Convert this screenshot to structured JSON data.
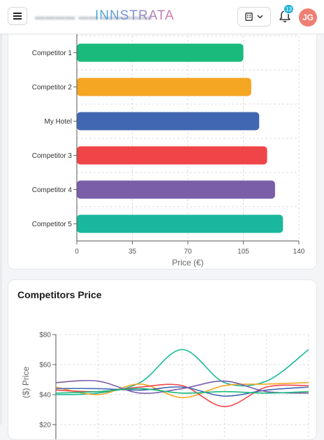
{
  "header": {
    "menu_icon": "hamburger-icon",
    "logo_text": "INNSTRATA",
    "hotel_selector_icon": "building-icon",
    "notification_count": "13",
    "avatar_initials": "JG"
  },
  "colors": {
    "competitor_1": "#1aba7d",
    "competitor_2": "#f5a623",
    "my_hotel": "#4267b2",
    "competitor_3": "#f04548",
    "competitor_4": "#7a5ea8",
    "competitor_5": "#19b89c",
    "badge": "#23b3d6",
    "avatar": "#ef7f73"
  },
  "price_card": {
    "chart_data": {
      "type": "bar",
      "orientation": "horizontal",
      "categories": [
        "Competitor 1",
        "Competitor 2",
        "My Hotel",
        "Competitor 3",
        "Competitor 4",
        "Competitor 5"
      ],
      "values": [
        105,
        110,
        115,
        120,
        125,
        130
      ],
      "colors": [
        "#1aba7d",
        "#f5a623",
        "#4267b2",
        "#f04548",
        "#7a5ea8",
        "#19b89c"
      ],
      "xlabel": "Price (€)",
      "ylabel": "",
      "xlim": [
        0,
        140
      ],
      "xticks": [
        "0",
        "35",
        "70",
        "105",
        "140"
      ],
      "grid": true
    }
  },
  "competitors_card": {
    "title": "Competitors Price",
    "chart_data": {
      "type": "line",
      "ylabel": "($) Price",
      "ylim": [
        20,
        80
      ],
      "yticks": [
        "$80",
        "$60",
        "$40",
        "$20"
      ],
      "x": [
        0,
        1,
        2,
        3,
        4,
        5,
        6
      ],
      "grid": true,
      "series": [
        {
          "color": "#19b89c",
          "values": [
            40,
            41,
            48,
            70,
            48,
            49,
            70
          ]
        },
        {
          "color": "#f5a623",
          "values": [
            45,
            40,
            47,
            38,
            46,
            47,
            48
          ]
        },
        {
          "color": "#f04548",
          "values": [
            43,
            42,
            45,
            46,
            32,
            45,
            46
          ]
        },
        {
          "color": "#4267b2",
          "values": [
            44,
            44,
            43,
            45,
            39,
            43,
            45
          ]
        },
        {
          "color": "#7a5ea8",
          "values": [
            48,
            49,
            41,
            44,
            49,
            42,
            41
          ]
        },
        {
          "color": "#1aba7d",
          "values": [
            41,
            42,
            44,
            41,
            42,
            41,
            42
          ]
        }
      ]
    }
  }
}
